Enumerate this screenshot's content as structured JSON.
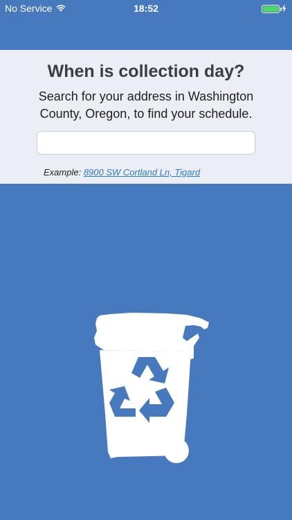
{
  "status_bar": {
    "carrier": "No Service",
    "time": "18:52",
    "battery_level": 1.0,
    "icons": [
      "wifi-icon",
      "battery-icon",
      "charging-bolt-icon"
    ]
  },
  "search": {
    "title": "When is collection day?",
    "subtitle": "Search for your address in Washington County, Oregon, to find your schedule.",
    "input_value": "",
    "example_label": "Example:",
    "example_link": "8900 SW Cortland Ln, Tigard"
  },
  "illustration": {
    "icon": "recycling-cart-icon"
  },
  "colors": {
    "background": "#4779BF",
    "panel": "#EBEEF4",
    "link": "#2F7BC6",
    "battery": "#4CD964"
  }
}
